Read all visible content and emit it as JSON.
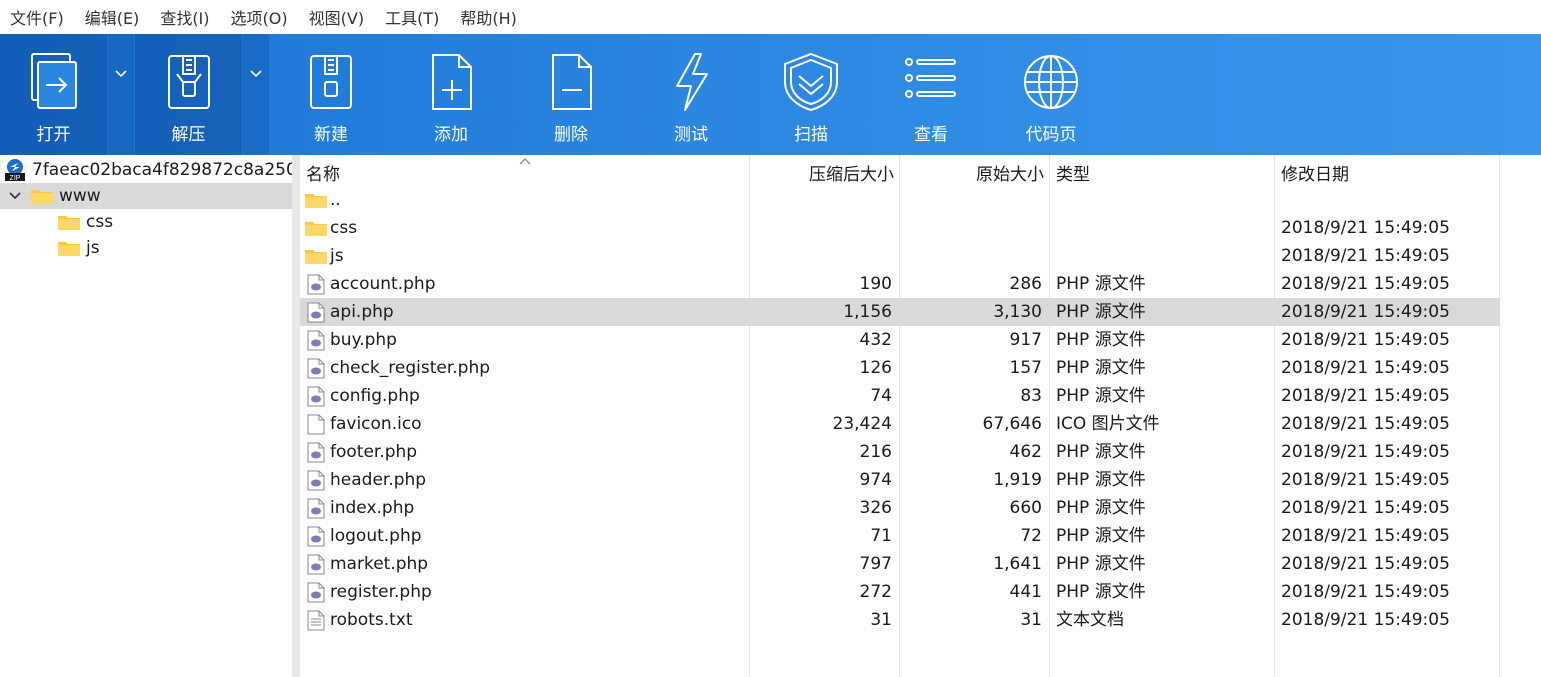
{
  "menu": [
    "文件(F)",
    "编辑(E)",
    "查找(I)",
    "选项(O)",
    "视图(V)",
    "工具(T)",
    "帮助(H)"
  ],
  "toolbar": {
    "open": "打开",
    "extract": "解压",
    "new": "新建",
    "add": "添加",
    "delete": "删除",
    "test": "测试",
    "scan": "扫描",
    "view": "查看",
    "codepage": "代码页"
  },
  "tree": {
    "archive": "7faeac02baca4f829872c8a250",
    "zip_badge": "ZIP",
    "root": "www",
    "children": [
      "css",
      "js"
    ]
  },
  "columns": {
    "name": "名称",
    "packed": "压缩后大小",
    "size": "原始大小",
    "type": "类型",
    "modified": "修改日期"
  },
  "files": [
    {
      "name": "..",
      "kind": "folder",
      "packed": "",
      "size": "",
      "type": "",
      "modified": ""
    },
    {
      "name": "css",
      "kind": "folder",
      "packed": "",
      "size": "",
      "type": "",
      "modified": "2018/9/21 15:49:05"
    },
    {
      "name": "js",
      "kind": "folder",
      "packed": "",
      "size": "",
      "type": "",
      "modified": "2018/9/21 15:49:05"
    },
    {
      "name": "account.php",
      "kind": "php",
      "packed": "190",
      "size": "286",
      "type": "PHP 源文件",
      "modified": "2018/9/21 15:49:05"
    },
    {
      "name": "api.php",
      "kind": "php",
      "packed": "1,156",
      "size": "3,130",
      "type": "PHP 源文件",
      "modified": "2018/9/21 15:49:05",
      "selected": true
    },
    {
      "name": "buy.php",
      "kind": "php",
      "packed": "432",
      "size": "917",
      "type": "PHP 源文件",
      "modified": "2018/9/21 15:49:05"
    },
    {
      "name": "check_register.php",
      "kind": "php",
      "packed": "126",
      "size": "157",
      "type": "PHP 源文件",
      "modified": "2018/9/21 15:49:05"
    },
    {
      "name": "config.php",
      "kind": "php",
      "packed": "74",
      "size": "83",
      "type": "PHP 源文件",
      "modified": "2018/9/21 15:49:05"
    },
    {
      "name": "favicon.ico",
      "kind": "file",
      "packed": "23,424",
      "size": "67,646",
      "type": "ICO 图片文件",
      "modified": "2018/9/21 15:49:05"
    },
    {
      "name": "footer.php",
      "kind": "php",
      "packed": "216",
      "size": "462",
      "type": "PHP 源文件",
      "modified": "2018/9/21 15:49:05"
    },
    {
      "name": "header.php",
      "kind": "php",
      "packed": "974",
      "size": "1,919",
      "type": "PHP 源文件",
      "modified": "2018/9/21 15:49:05"
    },
    {
      "name": "index.php",
      "kind": "php",
      "packed": "326",
      "size": "660",
      "type": "PHP 源文件",
      "modified": "2018/9/21 15:49:05"
    },
    {
      "name": "logout.php",
      "kind": "php",
      "packed": "71",
      "size": "72",
      "type": "PHP 源文件",
      "modified": "2018/9/21 15:49:05"
    },
    {
      "name": "market.php",
      "kind": "php",
      "packed": "797",
      "size": "1,641",
      "type": "PHP 源文件",
      "modified": "2018/9/21 15:49:05"
    },
    {
      "name": "register.php",
      "kind": "php",
      "packed": "272",
      "size": "441",
      "type": "PHP 源文件",
      "modified": "2018/9/21 15:49:05"
    },
    {
      "name": "robots.txt",
      "kind": "text",
      "packed": "31",
      "size": "31",
      "type": "文本文档",
      "modified": "2018/9/21 15:49:05"
    }
  ],
  "colors": {
    "toolbar": "#2b86e0",
    "selection": "#d9d9d9",
    "folder": "#ffc83d",
    "php": "#7b7fb5"
  }
}
